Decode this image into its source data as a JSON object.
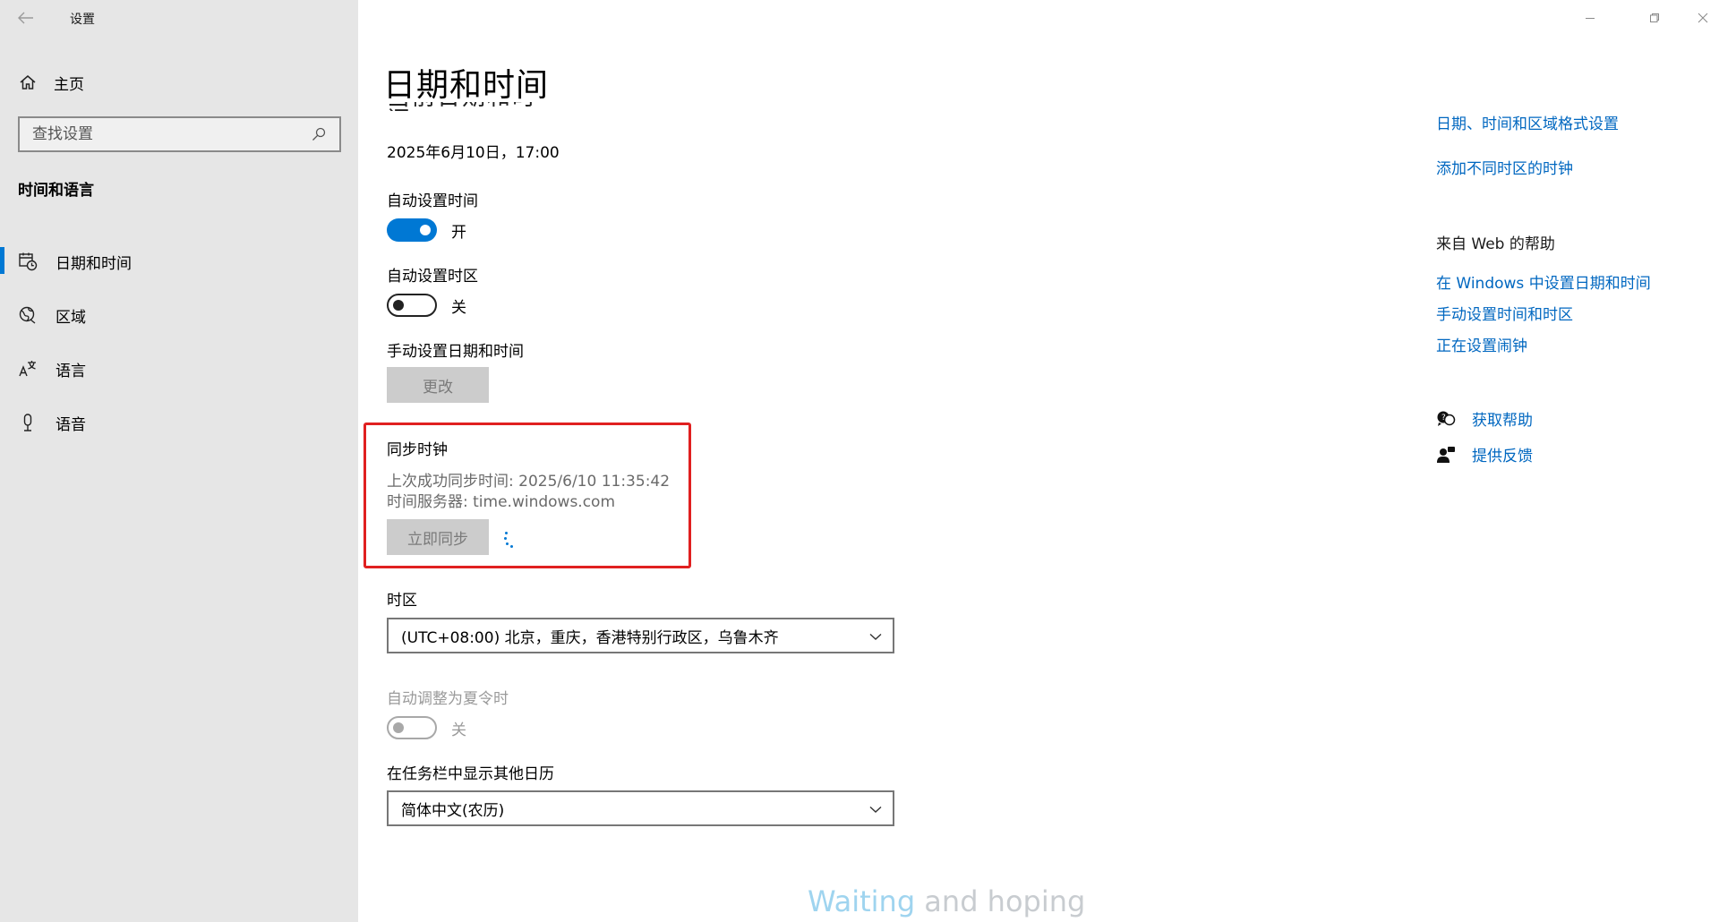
{
  "window": {
    "title": "设置",
    "minimize_icon": "minimize-icon",
    "restore_icon": "restore-icon",
    "close_icon": "close-icon"
  },
  "sidebar": {
    "home_label": "主页",
    "search_placeholder": "查找设置",
    "section_heading": "时间和语言",
    "items": [
      {
        "label": "日期和时间",
        "icon": "calendar-clock-icon",
        "active": true
      },
      {
        "label": "区域",
        "icon": "globe-icon",
        "active": false
      },
      {
        "label": "语言",
        "icon": "language-icon",
        "active": false
      },
      {
        "label": "语音",
        "icon": "microphone-icon",
        "active": false
      }
    ]
  },
  "main": {
    "page_title": "日期和时间",
    "current_datetime": "2025年6月10日，17:00",
    "auto_time": {
      "label": "自动设置时间",
      "state": "开"
    },
    "auto_timezone": {
      "label": "自动设置时区",
      "state": "关"
    },
    "manual": {
      "label": "手动设置日期和时间",
      "button": "更改"
    },
    "sync": {
      "title": "同步时钟",
      "last_sync": "上次成功同步时间: 2025/6/10 11:35:42",
      "server": "时间服务器: time.windows.com",
      "button": "立即同步"
    },
    "timezone": {
      "label": "时区",
      "value": "(UTC+08:00) 北京，重庆，香港特别行政区，乌鲁木齐"
    },
    "dst": {
      "label": "自动调整为夏令时",
      "state": "关"
    },
    "calendar": {
      "label": "在任务栏中显示其他日历",
      "value": "简体中文(农历)"
    }
  },
  "related": {
    "links": [
      "日期、时间和区域格式设置",
      "添加不同时区的时钟"
    ],
    "web_help_heading": "来自 Web 的帮助",
    "web_links": [
      "在 Windows 中设置日期和时间",
      "手动设置时间和时区",
      "正在设置闹钟"
    ],
    "get_help": "获取帮助",
    "feedback": "提供反馈"
  },
  "watermark": {
    "part1": "Waiting",
    "part2": " and hoping"
  },
  "colors": {
    "accent": "#0078d4",
    "link": "#0067c0",
    "highlight_border": "#e02020",
    "sidebar_bg": "#e6e6e6"
  }
}
